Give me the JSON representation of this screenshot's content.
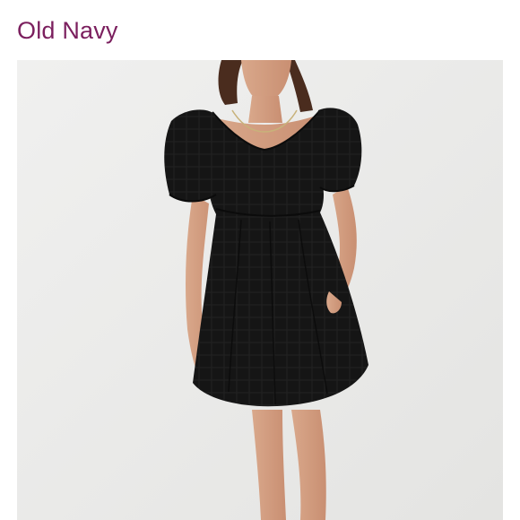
{
  "listing": {
    "brand": "Old Navy"
  },
  "photo": {
    "subject_icon": "dress-photo",
    "background_color": "#ebebea",
    "garment_color": "#151515"
  },
  "colors": {
    "brand_text": "#7b1f5e"
  }
}
